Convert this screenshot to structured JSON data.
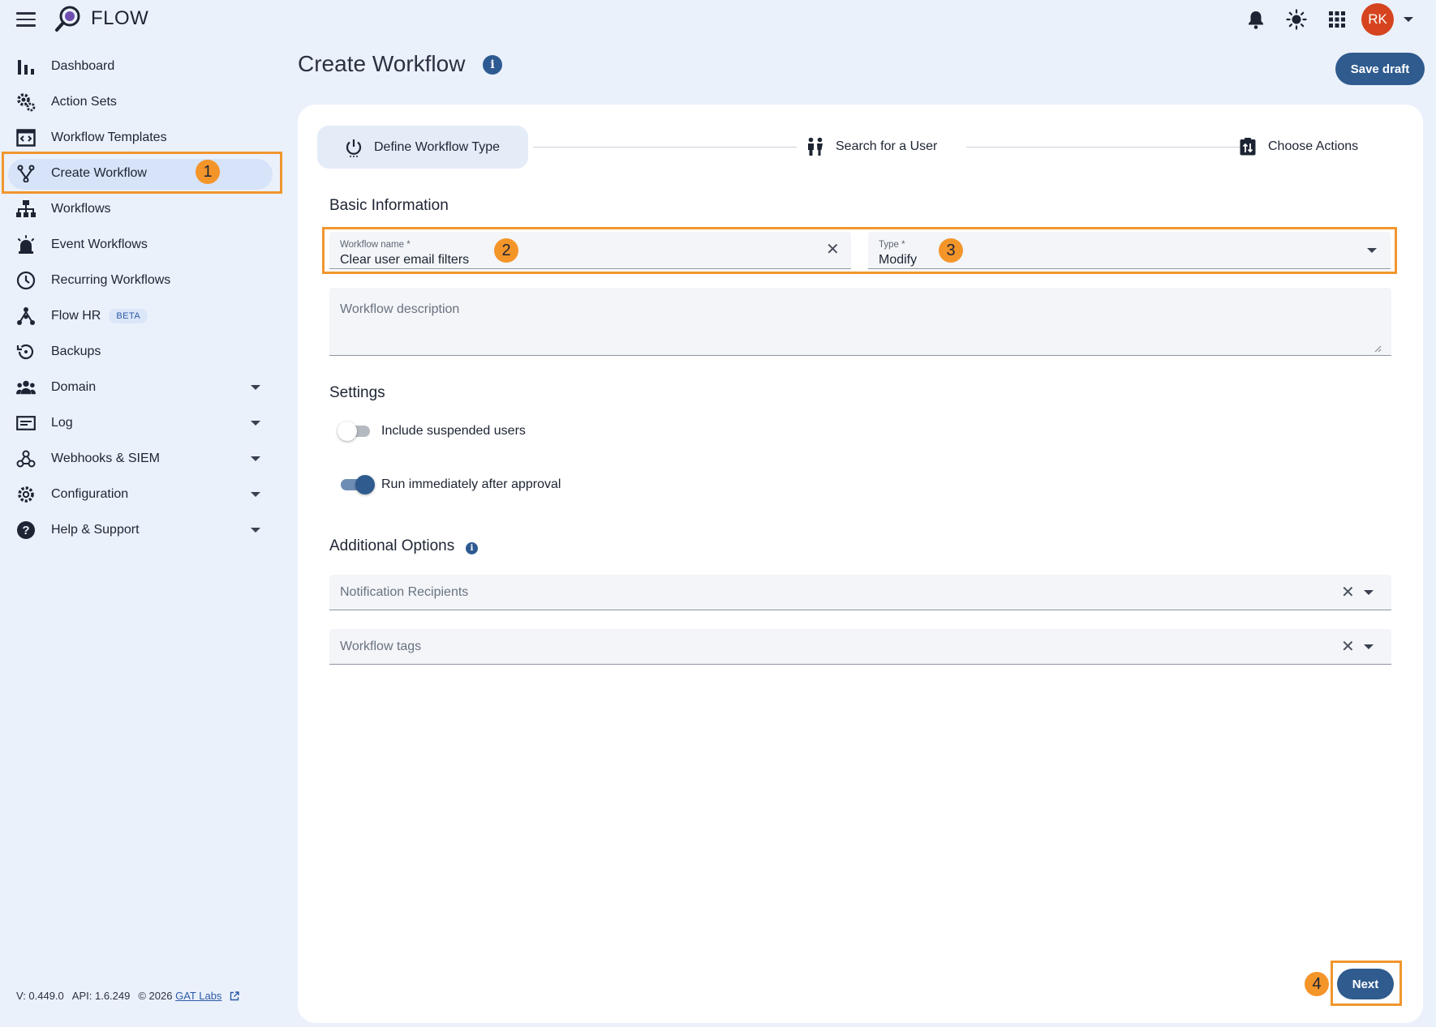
{
  "app": {
    "name": "FLOW",
    "avatar_initials": "RK"
  },
  "topbar": {
    "icons": [
      "menu-icon",
      "notifications-icon",
      "theme-icon",
      "apps-grid-icon",
      "account-caret-icon"
    ]
  },
  "sidebar": {
    "items": [
      {
        "label": "Dashboard",
        "icon": "bar-chart-icon"
      },
      {
        "label": "Action Sets",
        "icon": "gears-icon"
      },
      {
        "label": "Workflow Templates",
        "icon": "template-icon"
      },
      {
        "label": "Create Workflow",
        "icon": "fork-icon",
        "active": true
      },
      {
        "label": "Workflows",
        "icon": "sitemap-icon"
      },
      {
        "label": "Event Workflows",
        "icon": "alarm-light-icon"
      },
      {
        "label": "Recurring Workflows",
        "icon": "clock-icon"
      },
      {
        "label": "Flow HR",
        "icon": "hr-tree-icon",
        "badge": "BETA"
      },
      {
        "label": "Backups",
        "icon": "restore-icon"
      },
      {
        "label": "Domain",
        "icon": "people-icon",
        "expandable": true
      },
      {
        "label": "Log",
        "icon": "log-icon",
        "expandable": true
      },
      {
        "label": "Webhooks & SIEM",
        "icon": "webhook-icon",
        "expandable": true
      },
      {
        "label": "Configuration",
        "icon": "settings-icon",
        "expandable": true
      },
      {
        "label": "Help & Support",
        "icon": "help-icon",
        "expandable": true
      }
    ],
    "footer": {
      "version": "V: 0.449.0",
      "api": "API: 1.6.249",
      "copyright": "© 2026",
      "link": "GAT Labs"
    }
  },
  "header": {
    "title": "Create Workflow",
    "info": "i",
    "save_draft": "Save draft"
  },
  "stepper": {
    "steps": [
      {
        "label": "Define Workflow Type",
        "active": true
      },
      {
        "label": "Search for a User"
      },
      {
        "label": "Choose Actions"
      }
    ]
  },
  "basic_info": {
    "title": "Basic Information",
    "name_label": "Workflow name *",
    "name_value": "Clear user email filters",
    "type_label": "Type *",
    "type_value": "Modify",
    "description_placeholder": "Workflow description"
  },
  "settings": {
    "title": "Settings",
    "include_suspended": {
      "label": "Include suspended users",
      "on": false
    },
    "run_immediately": {
      "label": "Run immediately after approval",
      "on": true
    }
  },
  "additional": {
    "title": "Additional Options",
    "info": "i",
    "recipients_placeholder": "Notification Recipients",
    "tags_placeholder": "Workflow tags"
  },
  "annotations": {
    "badge1": "1",
    "badge2": "2",
    "badge3": "3",
    "badge4": "4",
    "color": "#f0962e"
  },
  "next_label": "Next",
  "colors": {
    "primary": "#2f5b8e",
    "background": "#ebf1fb",
    "highlight": "#f0962e",
    "avatar": "#d5441f"
  }
}
